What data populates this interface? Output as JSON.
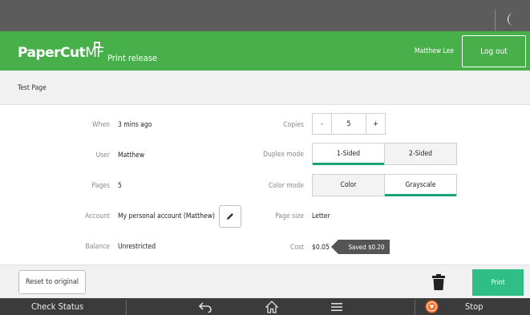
{
  "header": {
    "logo_main": "PaperCut",
    "logo_suffix": "MF",
    "app_title": "Print release",
    "user_name": "Matthew Lee",
    "logout_label": "Log out"
  },
  "job": {
    "title": "Test Page",
    "when_label": "When",
    "when_value": "3 mins ago",
    "user_label": "User",
    "user_value": "Matthew",
    "pages_label": "Pages",
    "pages_value": "5",
    "account_label": "Account",
    "account_value": "My personal account (Matthew)",
    "balance_label": "Balance",
    "balance_value": "Unrestricted"
  },
  "options": {
    "copies_label": "Copies",
    "copies_minus": "-",
    "copies_value": "5",
    "copies_plus": "+",
    "duplex_label": "Duplex mode",
    "duplex_options": [
      "1-Sided",
      "2-Sided"
    ],
    "duplex_selected": "1-Sided",
    "color_label": "Color mode",
    "color_options": [
      "Color",
      "Grayscale"
    ],
    "color_selected": "Grayscale",
    "pagesize_label": "Page size",
    "pagesize_value": "Letter",
    "cost_label": "Cost",
    "cost_value": "$0.05",
    "saved_badge": "Saved $0.20"
  },
  "actions": {
    "reset_label": "Reset to original",
    "print_label": "Print"
  },
  "system": {
    "check_status": "Check Status",
    "stop": "Stop"
  },
  "colors": {
    "brand_green": "#47b04b",
    "accent_teal": "#1aa37a",
    "print_button": "#2fbf86",
    "stop_orange": "#f26522"
  }
}
